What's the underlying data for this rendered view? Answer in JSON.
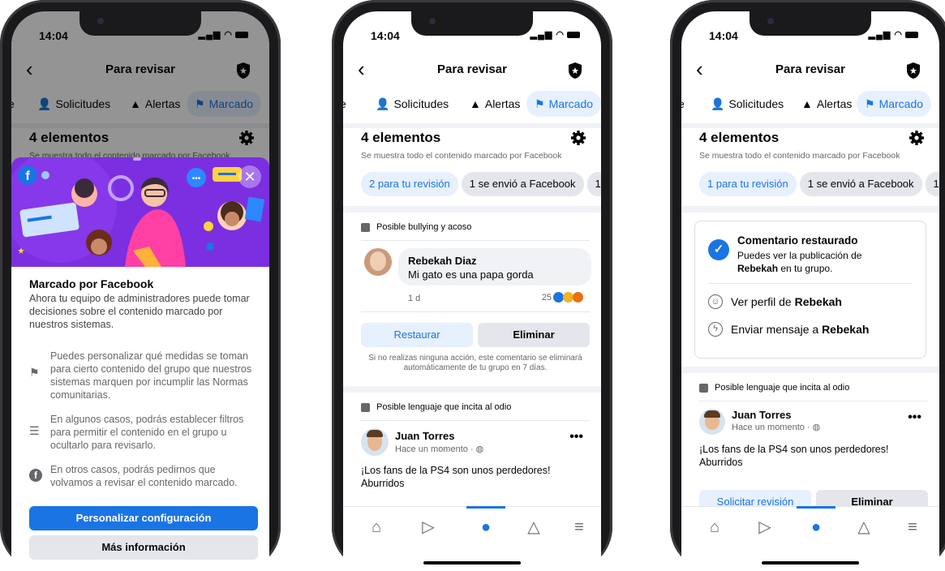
{
  "phones": [
    {
      "status": {
        "time": "14:04"
      },
      "header": {
        "title": "Para revisar"
      },
      "tabs": [
        {
          "label": "Solicitudes"
        },
        {
          "label": "Alertas"
        },
        {
          "label": "Marcado"
        }
      ],
      "items": {
        "count": "4 elementos",
        "subtitle": "Se muestra todo el contenido marcado por Facebook"
      },
      "sheet": {
        "title": "Marcado por Facebook",
        "intro": "Ahora tu equipo de administradores puede tomar decisiones sobre el contenido marcado por nuestros sistemas.",
        "points": [
          {
            "icon": "flag-icon",
            "text": "Puedes personalizar qué medidas se toman para cierto contenido del grupo que nuestros sistemas marquen por incumplir las Normas comunitarias."
          },
          {
            "icon": "filter-icon",
            "text": "En algunos casos, podrás establecer filtros para permitir el contenido en el grupo u ocultarlo para revisarlo."
          },
          {
            "icon": "facebook-icon",
            "text": "En otros casos, podrás pedirnos que volvamos a revisar el contenido marcado."
          }
        ],
        "primary_button": "Personalizar configuración",
        "secondary_button": "Más información"
      }
    },
    {
      "status": {
        "time": "14:04"
      },
      "header": {
        "title": "Para revisar"
      },
      "tabs": [
        {
          "label": "Solicitudes"
        },
        {
          "label": "Alertas"
        },
        {
          "label": "Marcado"
        }
      ],
      "items": {
        "count": "4 elementos",
        "subtitle": "Se muestra todo el contenido marcado por Facebook"
      },
      "chips": [
        {
          "label": "2 para tu revisión"
        },
        {
          "label": "1 se envió a Facebook"
        },
        {
          "label": "1"
        }
      ],
      "post1": {
        "flag": "Posible bullying y acoso",
        "author": "Rebekah Diaz",
        "text": "Mi gato es una papa gorda",
        "time": "1 d",
        "reactions": "25",
        "restore_button": "Restaurar",
        "delete_button": "Eliminar",
        "notice": "Si no realizas ninguna acción, este comentario se eliminará automáticamente de tu grupo en 7 días."
      },
      "post2": {
        "flag": "Posible lenguaje que incita al odio",
        "author": "Juan Torres",
        "time": "Hace un momento · ",
        "text": "¡Los fans de la PS4 son unos perdedores! Aburridos"
      }
    },
    {
      "status": {
        "time": "14:04"
      },
      "header": {
        "title": "Para revisar"
      },
      "tabs": [
        {
          "label": "Solicitudes"
        },
        {
          "label": "Alertas"
        },
        {
          "label": "Marcado"
        }
      ],
      "items": {
        "count": "4 elementos",
        "subtitle": "Se muestra todo el contenido marcado por Facebook"
      },
      "chips": [
        {
          "label": "1 para tu revisión"
        },
        {
          "label": "1 se envió a Facebook"
        },
        {
          "label": "1"
        }
      ],
      "restored": {
        "title": "Comentario restaurado",
        "desc_a": "Puedes ver la publicación de",
        "desc_name": "Rebekah",
        "desc_b": " en tu grupo.",
        "profile_a": "Ver perfil de ",
        "profile_name": "Rebekah",
        "message_a": "Enviar mensaje a ",
        "message_name": "Rebekah"
      },
      "post2": {
        "flag": "Posible lenguaje que incita al odio",
        "author": "Juan Torres",
        "time": "Hace un momento · ",
        "text": "¡Los fans de la PS4 son unos perdedores! Aburridos",
        "review_button": "Solicitar revisión",
        "delete_button": "Eliminar"
      }
    }
  ],
  "colors": {
    "accent": "#1b74e4",
    "hero": "#7b2fe0",
    "bg_gray": "#f0f2f5"
  }
}
